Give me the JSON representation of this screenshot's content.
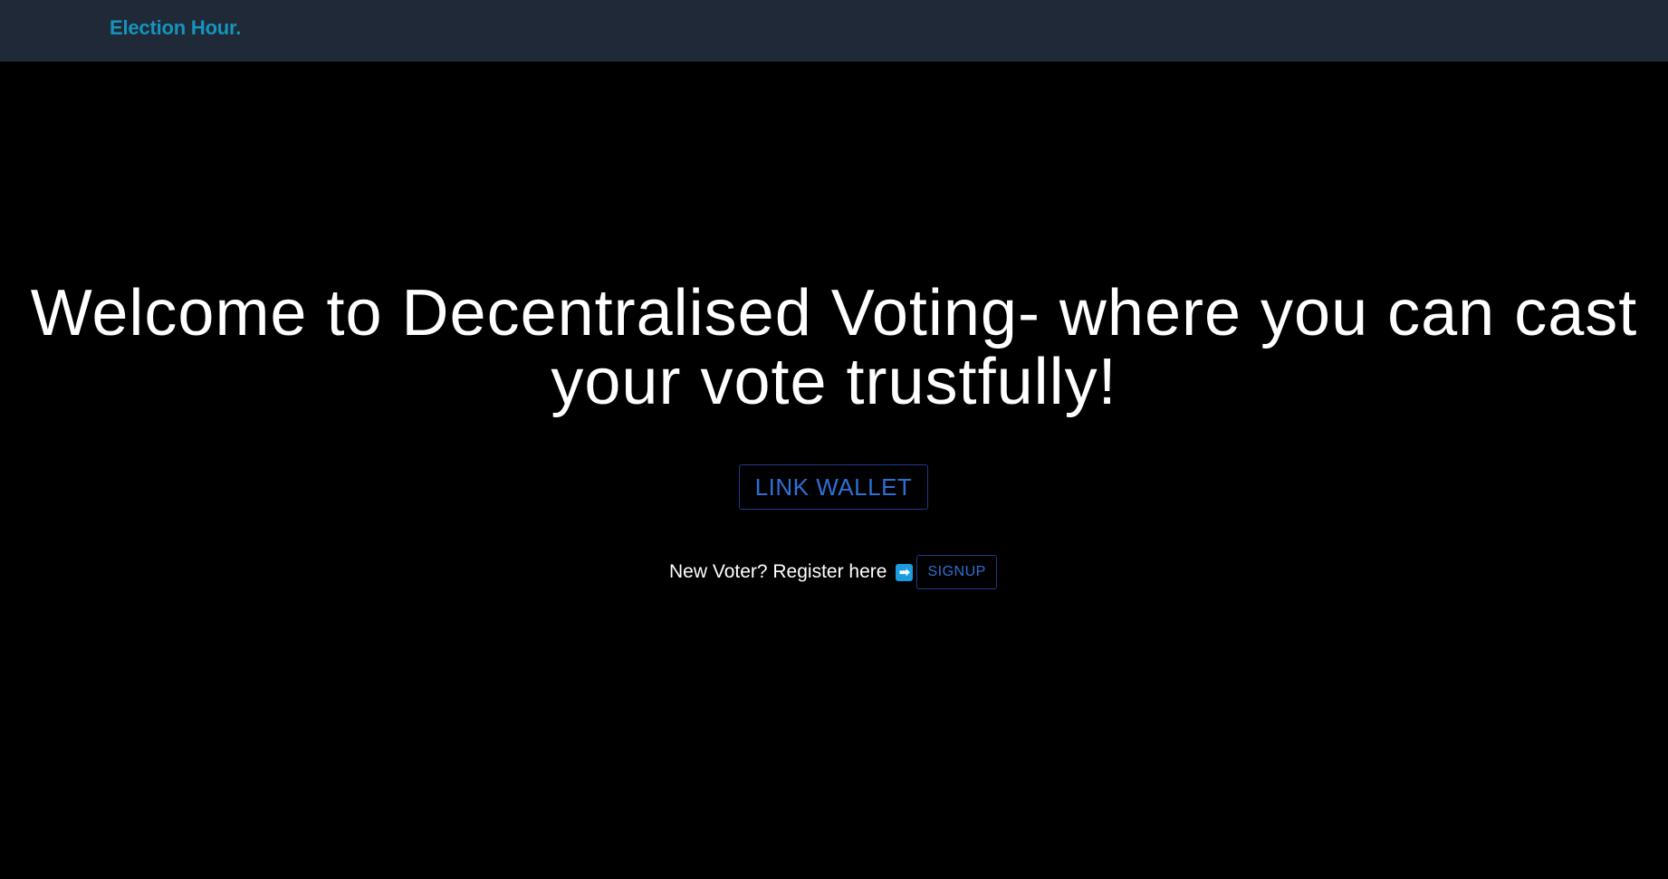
{
  "header": {
    "brand": "Election Hour."
  },
  "hero": {
    "headline": "Welcome to Decentralised Voting- where you can cast your vote trustfully!",
    "link_wallet_label": "LINK WALLET"
  },
  "register": {
    "prompt": "New Voter? Register here",
    "arrow_icon": "right-arrow-icon",
    "arrow_glyph": "➡",
    "signup_label": "SIGNUP"
  },
  "colors": {
    "topbar_bg": "#1f2937",
    "page_bg": "#000000",
    "brand": "#1594be",
    "accent": "#2f6fd6",
    "button_border": "#1e3a8a"
  }
}
